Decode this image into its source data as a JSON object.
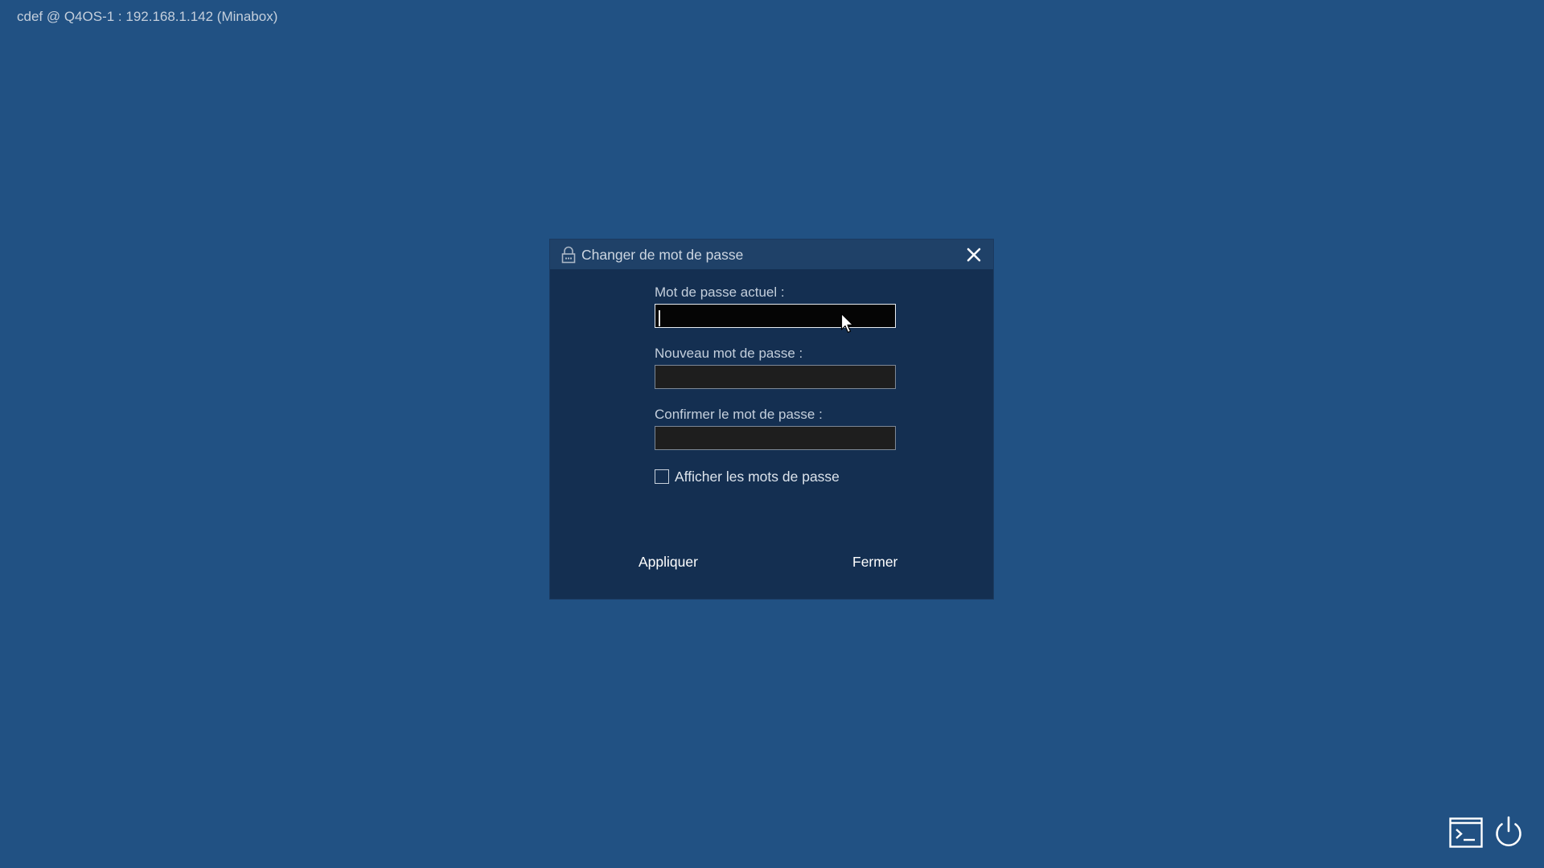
{
  "session": {
    "label": "cdef @ Q4OS-1 : 192.168.1.142 (Minabox)"
  },
  "dialog": {
    "title": "Changer de mot de passe",
    "icons": {
      "title": "lock-icon",
      "close": "close-icon"
    },
    "fields": [
      {
        "label": "Mot de passe actuel :",
        "value": "",
        "focused": true
      },
      {
        "label": "Nouveau mot de passe :",
        "value": "",
        "focused": false
      },
      {
        "label": "Confirmer le mot de passe :",
        "value": "",
        "focused": false
      }
    ],
    "show_passwords": {
      "label": "Afficher les mots de passe",
      "checked": false
    },
    "buttons": {
      "apply": "Appliquer",
      "close": "Fermer"
    }
  },
  "taskbar": {
    "icons": [
      "terminal-icon",
      "power-icon"
    ]
  },
  "colors": {
    "desktop_background": "#215183",
    "dialog_background": "#142f51",
    "titlebar_background": "#1f4168",
    "field_background": "#1e1e1e"
  }
}
